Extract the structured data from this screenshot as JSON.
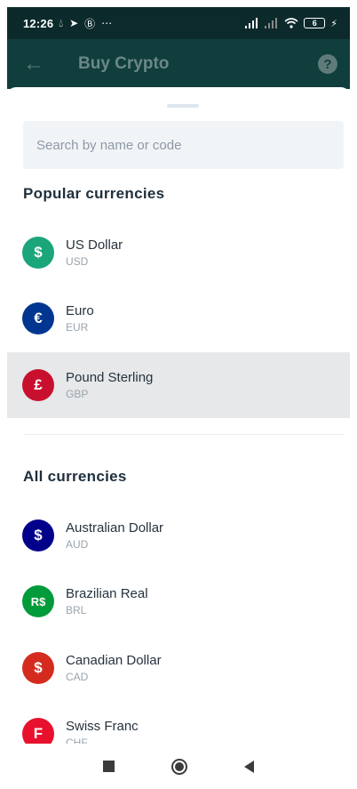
{
  "status_bar": {
    "time": "12:26",
    "icons": [
      "drop-icon",
      "send-icon",
      "b-circle-icon",
      "more-dots-icon"
    ],
    "battery": "6",
    "right_icons": [
      "signal-icon",
      "signal-icon",
      "wifi-icon",
      "battery-icon",
      "charging-icon"
    ]
  },
  "app_bar": {
    "title": "Buy Crypto",
    "back_icon": "arrow-left-icon",
    "help_icon": "help-circle-icon"
  },
  "search": {
    "placeholder": "Search by name or code"
  },
  "popular": {
    "title": "Popular currencies",
    "items": [
      {
        "name": "US Dollar",
        "code": "USD",
        "symbol": "$",
        "color": "#1aa67a",
        "selected": false
      },
      {
        "name": "Euro",
        "code": "EUR",
        "symbol": "€",
        "color": "#00368f",
        "selected": false
      },
      {
        "name": "Pound Sterling",
        "code": "GBP",
        "symbol": "£",
        "color": "#c8102e",
        "selected": true
      }
    ]
  },
  "all": {
    "title": "All currencies",
    "items": [
      {
        "name": "Australian Dollar",
        "code": "AUD",
        "symbol": "$",
        "color": "#00008b"
      },
      {
        "name": "Brazilian Real",
        "code": "BRL",
        "symbol": "R$",
        "color": "#009b3a"
      },
      {
        "name": "Canadian Dollar",
        "code": "CAD",
        "symbol": "$",
        "color": "#d52b1e"
      },
      {
        "name": "Swiss Franc",
        "code": "CHF",
        "symbol": "F",
        "color": "#e8112d"
      }
    ]
  },
  "nav_bar": {
    "icons": [
      "recents-icon",
      "home-icon",
      "back-icon"
    ]
  },
  "colors": {
    "header_bg": "#0f3e3d",
    "status_bg": "#0c2a2c",
    "selected_row": "#e6e8e9"
  }
}
